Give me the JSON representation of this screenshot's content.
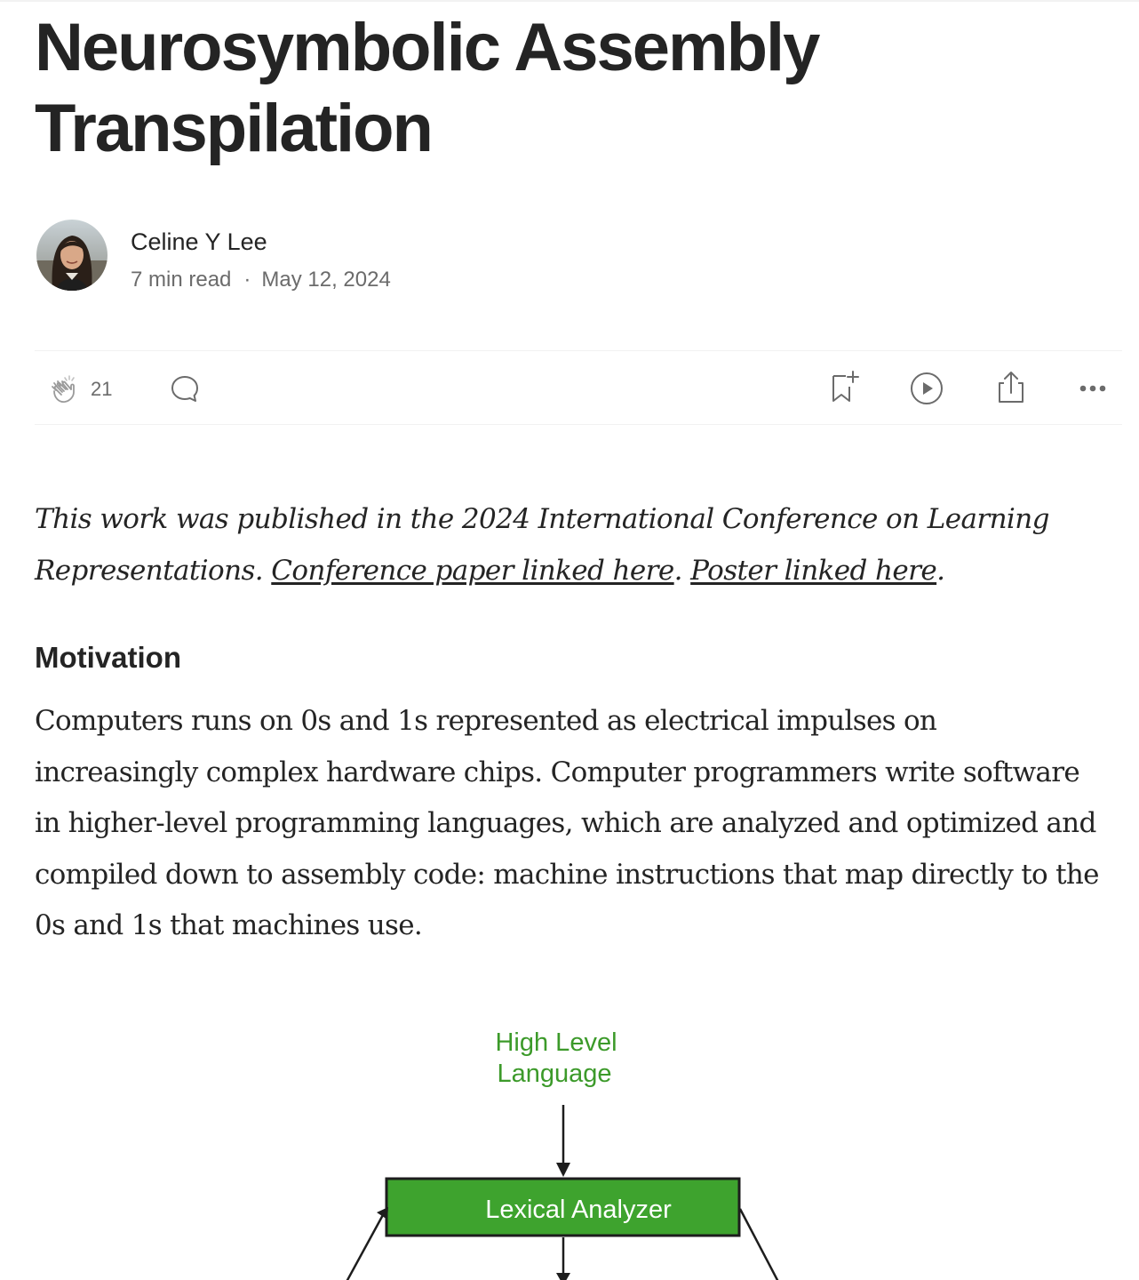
{
  "article": {
    "title_line1": "Neurosymbolic Assembly",
    "title_line2": "Transpilation"
  },
  "author": {
    "name": "Celine Y Lee",
    "read_time": "7 min read",
    "separator": "·",
    "date": "May 12, 2024"
  },
  "actions": {
    "clap_count": "21",
    "icons": [
      "clap-icon",
      "comment-icon",
      "bookmark-add-icon",
      "play-icon",
      "share-icon",
      "more-icon"
    ]
  },
  "intro": {
    "text_before": "This work was published in the 2024 International Conference on Learning Representations. ",
    "link_paper": "Conference paper linked here",
    "between": ". ",
    "link_poster": "Poster linked here",
    "after": "."
  },
  "section": {
    "heading": "Motivation",
    "paragraph": "Computers runs on 0s and 1s represented as electrical impulses on increasingly complex hardware chips. Computer programmers write software in higher-level programming languages, which are analyzed and optimized and compiled down to assembly code: machine instructions that map directly to the 0s and 1s that machines use."
  },
  "figure": {
    "top_label_line1": "High Level",
    "top_label_line2": "Language",
    "box_label": "Lexical Analyzer",
    "colors": {
      "label_green": "#3c9a2a",
      "box_fill": "#3ea32e",
      "box_border": "#1d1d1d",
      "box_text": "#ffffff"
    }
  },
  "colors": {
    "text": "#242424",
    "muted": "#6b6b6b",
    "divider": "#f2f2f2"
  }
}
